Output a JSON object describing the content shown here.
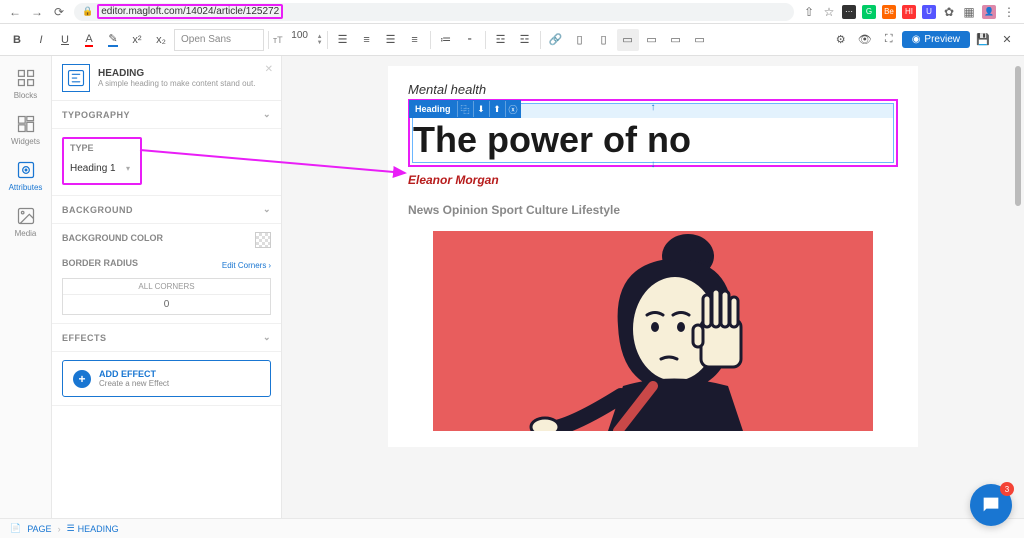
{
  "browser": {
    "url_prefix": "editor.magloft.com",
    "url_path": "/14024/article/125272"
  },
  "toolbar": {
    "font_family": "Open Sans",
    "font_size": "100",
    "preview": "Preview"
  },
  "sidebar_icons": {
    "blocks": "Blocks",
    "widgets": "Widgets",
    "attributes": "Attributes",
    "media": "Media"
  },
  "props": {
    "widget": {
      "title": "HEADING",
      "subtitle": "A simple heading to make content stand out."
    },
    "sections": {
      "typography": "TYPOGRAPHY",
      "background": "BACKGROUND",
      "effects": "EFFECTS"
    },
    "type_label": "TYPE",
    "type_value": "Heading 1",
    "bg_color_label": "BACKGROUND COLOR",
    "border_radius_label": "BORDER RADIUS",
    "edit_corners": "Edit Corners",
    "all_corners_label": "ALL CORNERS",
    "all_corners_value": "0",
    "add_effect_title": "ADD EFFECT",
    "add_effect_sub": "Create a new Effect"
  },
  "canvas": {
    "selected_label": "Heading",
    "category": "Mental health",
    "heading": "The power of no",
    "author": "Eleanor Morgan",
    "nav": "News Opinion Sport Culture Lifestyle"
  },
  "footer": {
    "page": "PAGE",
    "heading": "HEADING"
  },
  "chat": {
    "badge": "3"
  }
}
